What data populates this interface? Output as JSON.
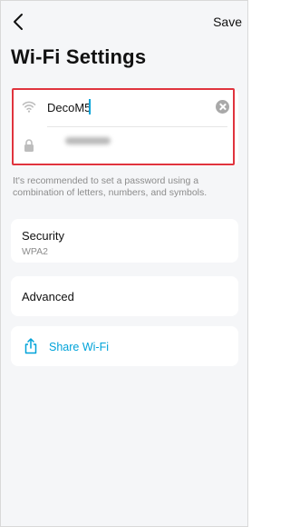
{
  "header": {
    "save_label": "Save",
    "title": "Wi-Fi Settings"
  },
  "wifi": {
    "ssid_value": "DecoM5",
    "password_placeholder": ""
  },
  "hint": "It's recommended to set a password using a combination of letters, numbers, and symbols.",
  "security": {
    "label": "Security",
    "value": "WPA2"
  },
  "advanced": {
    "label": "Advanced"
  },
  "share": {
    "label": "Share Wi-Fi"
  },
  "colors": {
    "accent": "#00a3d9",
    "highlight": "#e0343e",
    "background": "#f5f6f8",
    "secondary_text": "#8c8c8c"
  },
  "icons": {
    "back": "chevron-left-icon",
    "ssid": "wifi-icon",
    "password": "lock-icon",
    "clear": "clear-icon",
    "share": "share-icon"
  }
}
